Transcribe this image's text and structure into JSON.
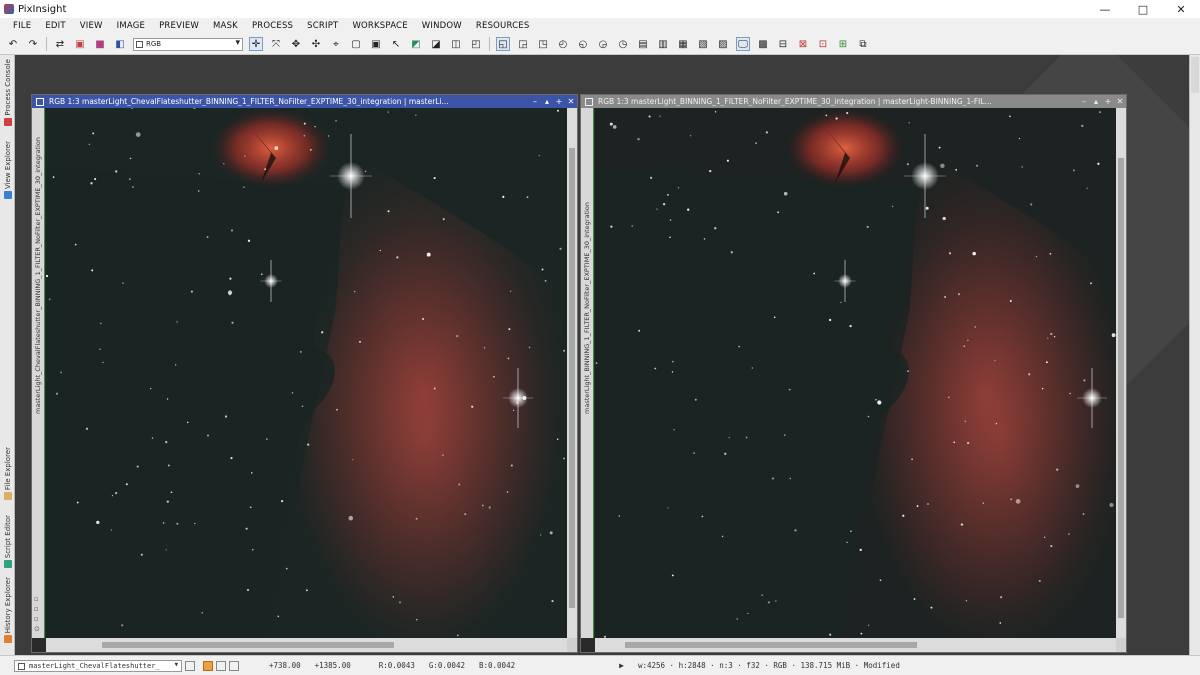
{
  "app": {
    "title": "PixInsight",
    "window_controls": [
      "—",
      "□",
      "✕"
    ]
  },
  "menu": [
    "FILE",
    "EDIT",
    "VIEW",
    "IMAGE",
    "PREVIEW",
    "MASK",
    "PROCESS",
    "SCRIPT",
    "WORKSPACE",
    "WINDOW",
    "RESOURCES"
  ],
  "toolbar": {
    "channel_value": "RGB"
  },
  "left_dock": {
    "tabs": [
      "Process Console",
      "View Explorer",
      "File Explorer",
      "Script Editor",
      "History Explorer"
    ]
  },
  "windows": {
    "left": {
      "title": "RGB 1:3 masterLight_ChevalFlateshutter_BINNING_1_FILTER_NoFilter_EXPTIME_30_integration | masterLi...",
      "side_label": "masterLight_ChevalFlateshutter_BINNING_1_FILTER_NoFilter_EXPTIME_30_integration",
      "controls": [
        "–",
        "▴",
        "+",
        "✕"
      ]
    },
    "right": {
      "title": "RGB 1:3 masterLight_BINNING_1_FILTER_NoFilter_EXPTIME_30_integration | masterLight-BINNING_1-FIL...",
      "side_label": "masterLight_BINNING_1_FILTER_NoFilter_EXPTIME_30_integration",
      "controls": [
        "–",
        "▴",
        "+",
        "✕"
      ]
    }
  },
  "status": {
    "view": "masterLight_ChevalFlateshutter_",
    "x": "+738.00",
    "y": "+1385.00",
    "r": "R:0.0043",
    "g": "G:0.0042",
    "b": "B:0.0042",
    "info": "w:4256 · h:2848 · n:3 · f32 · RGB · 138.715 MiB · Modified"
  },
  "colors": {
    "active_title": "#3d55a8",
    "inactive_title": "#8a8a8a",
    "nebula": "#b43a32"
  }
}
